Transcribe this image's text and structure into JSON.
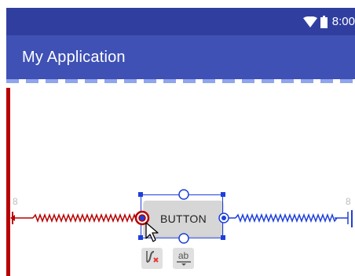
{
  "status_bar": {
    "time": "8:00",
    "wifi_icon": "wifi-icon",
    "battery_icon": "battery-icon",
    "color": "#303f9f"
  },
  "app_bar": {
    "title": "My Application",
    "color": "#3f51b5"
  },
  "widget": {
    "label": "BUTTON"
  },
  "constraints": {
    "left_margin": "8",
    "right_margin": "8",
    "left_color": "#b70000",
    "right_color": "#1e3fd9"
  },
  "toolbar": {
    "clear_constraints_icon": "clear-constraints-icon",
    "baseline_label": "ab"
  }
}
